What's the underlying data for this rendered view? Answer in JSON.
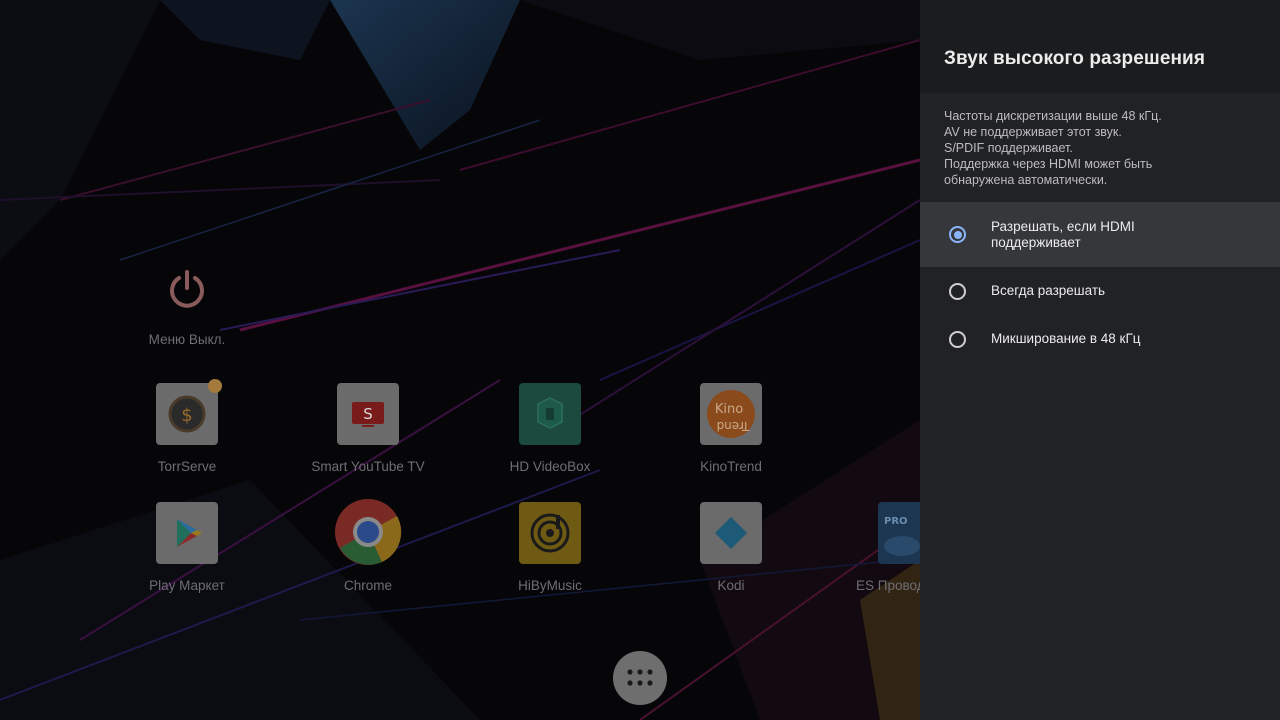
{
  "launcher": {
    "power_item": {
      "label": "Меню Выкл.",
      "icon": "power-icon"
    },
    "apps": [
      {
        "name": "torrserve",
        "label": "TorrServe",
        "icon": "torrserve-icon",
        "has_badge": true
      },
      {
        "name": "smart-youtube-tv",
        "label": "Smart YouTube TV",
        "icon": "youtube-icon"
      },
      {
        "name": "hd-videobox",
        "label": "HD VideoBox",
        "icon": "videobox-icon"
      },
      {
        "name": "kinotrend",
        "label": "KinoTrend",
        "icon": "kinotrend-icon",
        "icon_text": "Kino"
      },
      {
        "name": "play-market",
        "label": "Play Маркет",
        "icon": "play-store-icon"
      },
      {
        "name": "chrome",
        "label": "Chrome",
        "icon": "chrome-icon"
      },
      {
        "name": "hibymusic",
        "label": "HiByMusic",
        "icon": "hiby-icon"
      },
      {
        "name": "kodi",
        "label": "Kodi",
        "icon": "kodi-icon"
      },
      {
        "name": "es-explorer",
        "label": "ES Проводник",
        "icon": "es-explorer-icon",
        "icon_text": "PRO"
      }
    ],
    "all_apps_button": {
      "icon": "apps-grid-icon"
    }
  },
  "panel": {
    "title": "Звук высокого разрешения",
    "description": [
      "Частоты дискретизации выше 48 кГц.",
      "AV не поддерживает этот звук.",
      "S/PDIF поддерживает.",
      "Поддержка через HDMI может быть",
      "обнаружена автоматически."
    ],
    "options": [
      {
        "label": "Разрешать, если HDMI поддерживает",
        "selected": true,
        "focused": true
      },
      {
        "label": "Всегда разрешать",
        "selected": false,
        "focused": false
      },
      {
        "label": "Микширование в 48 кГц",
        "selected": false,
        "focused": false
      }
    ]
  },
  "colors": {
    "panel_bg": "#212225",
    "header_bg": "#1b1c1e",
    "focus_bg": "#35373a",
    "accent": "#8ab4f8"
  }
}
